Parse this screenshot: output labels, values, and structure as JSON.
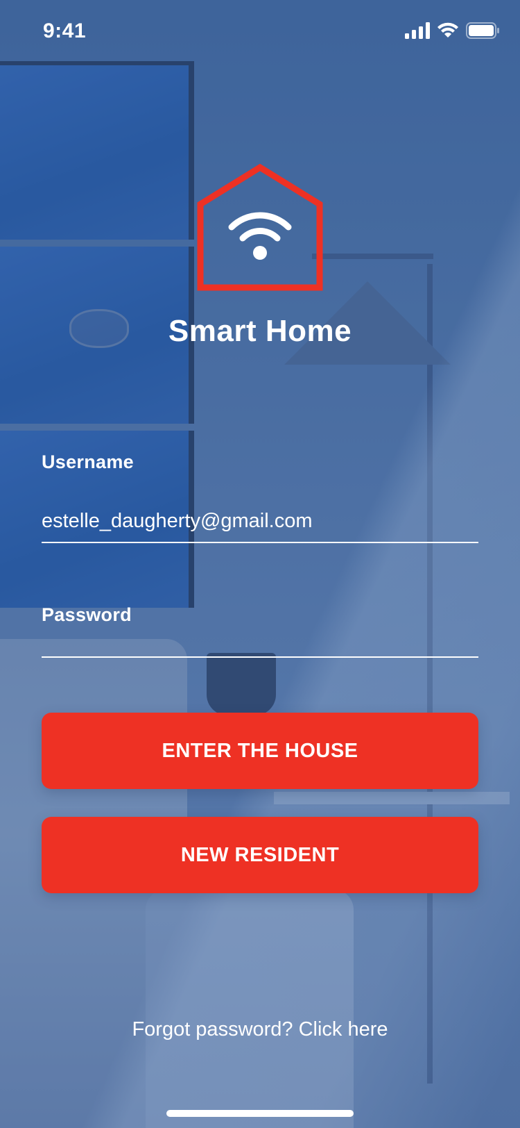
{
  "status_bar": {
    "time": "9:41",
    "icons": [
      "signal-icon",
      "wifi-icon",
      "battery-icon"
    ]
  },
  "logo": {
    "icon": "house-wifi-icon",
    "outline_color": "#ee3124"
  },
  "app_title": "Smart Home",
  "form": {
    "username_label": "Username",
    "username_value": "estelle_daugherty@gmail.com",
    "password_label": "Password",
    "password_value": ""
  },
  "buttons": {
    "enter_label": "ENTER THE HOUSE",
    "new_resident_label": "NEW RESIDENT"
  },
  "forgot_password_text": "Forgot password? Click here",
  "colors": {
    "accent": "#ee3124",
    "text": "#ffffff",
    "background_tint": "#4a6ea3"
  }
}
